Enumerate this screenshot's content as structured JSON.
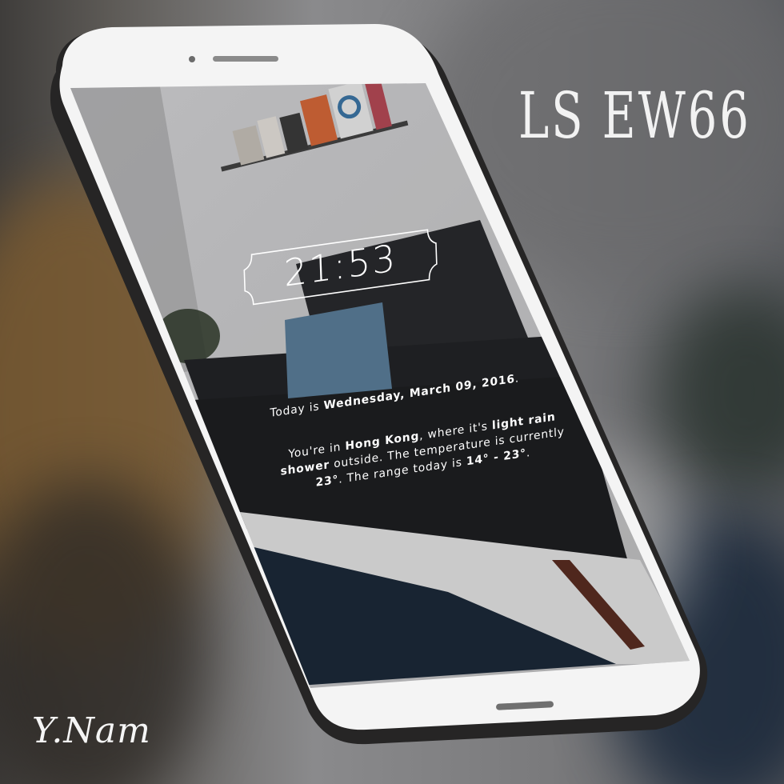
{
  "watermark": {
    "title": "LS EW66",
    "signature": "Y.Nam"
  },
  "lockscreen": {
    "clock": "21:53",
    "today_prefix": "Today is ",
    "today_date": "Wednesday, March 09, 2016",
    "today_suffix": ".",
    "weather": {
      "p1": "You're in ",
      "city": "Hong Kong",
      "p2": ", where it's ",
      "condition": "light rain shower",
      "p3": " outside. The temperature is currently ",
      "temp": "23°",
      "p4": ". The range today is ",
      "range": "14° - 23°",
      "p5": "."
    }
  },
  "colors": {
    "phone_body": "#f4f4f4",
    "phone_edge": "#2b2a2a",
    "wall": "#c9c9cb",
    "sofa": "#26272a",
    "pillow": "#5c7f9b",
    "rug": "#1c2a3a"
  }
}
